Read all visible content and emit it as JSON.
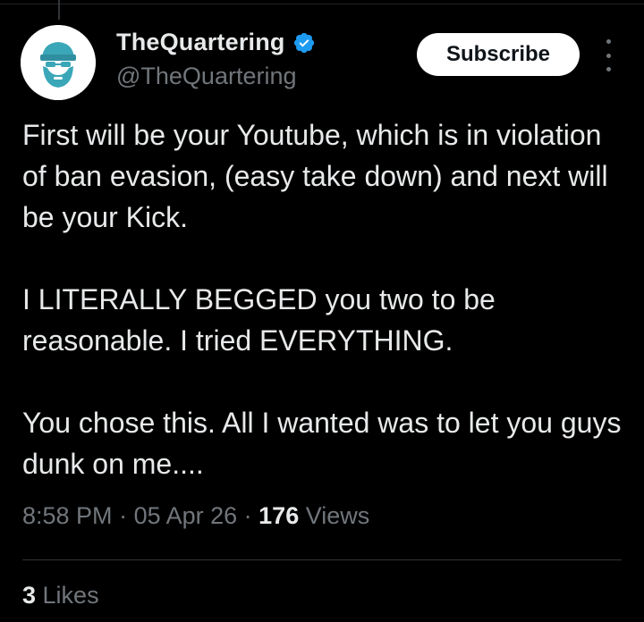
{
  "author": {
    "display_name": "TheQuartering",
    "handle": "@TheQuartering",
    "verified": true,
    "verified_icon": "verified-badge-icon",
    "avatar_icon": "bearded-man-avatar"
  },
  "actions": {
    "subscribe_label": "Subscribe",
    "more_icon": "more-options-icon"
  },
  "tweet": {
    "paragraphs": [
      "First will be your Youtube, which is in violation of ban evasion, (easy take down) and next will be your Kick.",
      "I LITERALLY BEGGED you two to be reasonable.  I tried EVERYTHING.",
      "You chose this.  All I wanted was to let you guys dunk on me...."
    ]
  },
  "meta": {
    "time": "8:58 PM",
    "separator": " · ",
    "date": "05 Apr 26",
    "views_count": "176",
    "views_label": " Views"
  },
  "engagement": {
    "likes_count": "3",
    "likes_label": " Likes"
  },
  "colors": {
    "background": "#000000",
    "text_primary": "#e7e9ea",
    "text_secondary": "#71767b",
    "verified_blue": "#1d9bf0",
    "avatar_teal": "#3aa7b8",
    "button_bg": "#ffffff"
  }
}
